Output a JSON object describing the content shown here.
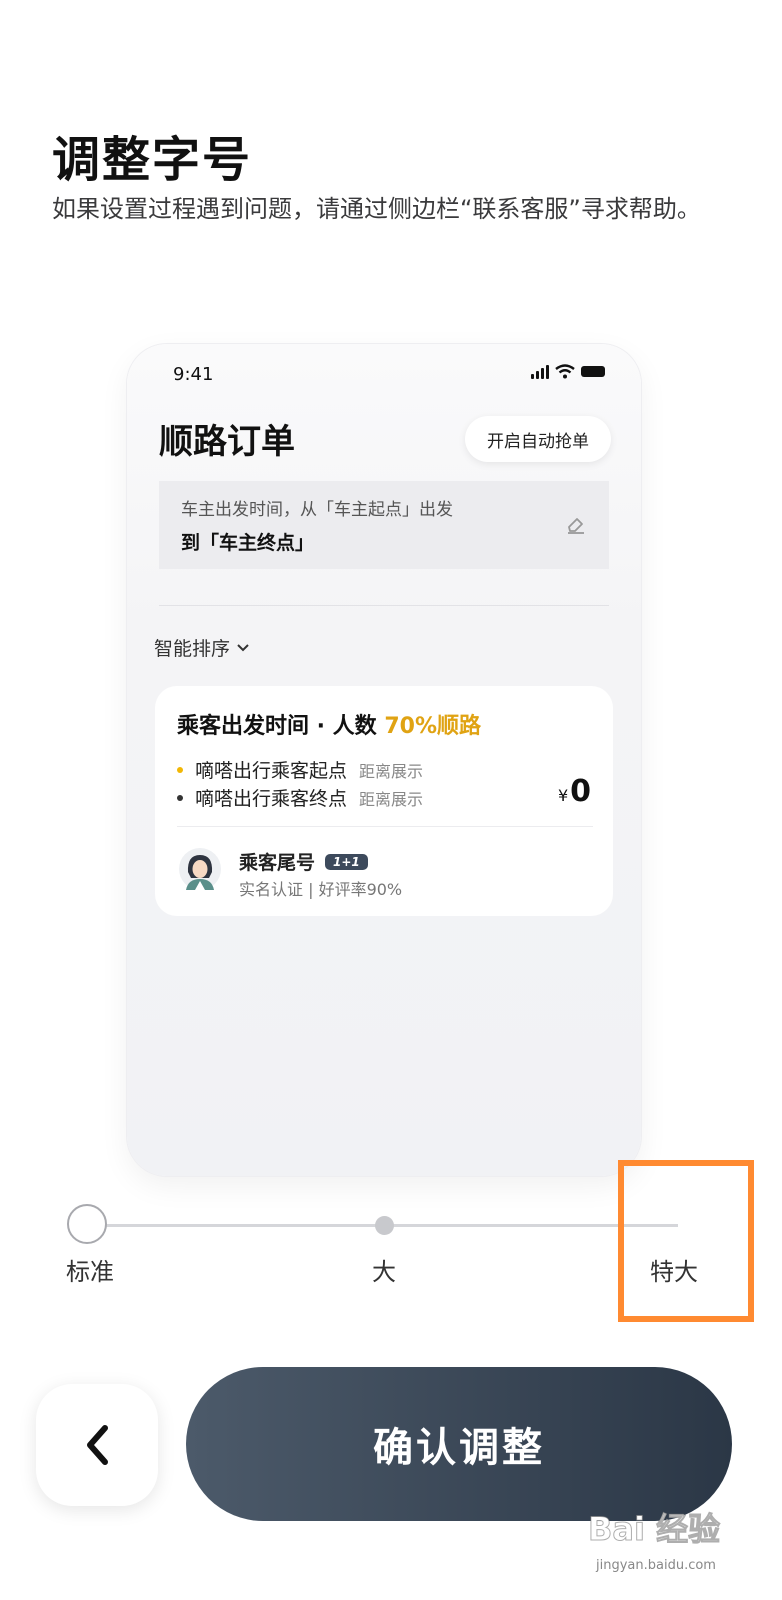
{
  "page": {
    "title": "调整字号",
    "description": "如果设置过程遇到问题，请通过侧边栏“联系客服”寻求帮助。"
  },
  "preview": {
    "status_time": "9:41",
    "order_title": "顺路订单",
    "auto_grab_label": "开启自动抢单",
    "route_line1": "车主出发时间，从「车主起点」出发",
    "route_line2": "到「车主终点」",
    "sort_label": "智能排序",
    "card": {
      "head_text": "乘客出发时间 · 人数",
      "match_percent": "70%顺路",
      "start_point": "嘀嗒出行乘客起点",
      "start_sub": "距离展示",
      "end_point": "嘀嗒出行乘客终点",
      "end_sub": "距离展示",
      "price_symbol": "¥",
      "price_value": "0",
      "passenger_name": "乘客尾号",
      "passenger_badge": "1+1",
      "passenger_info": "实名认证 | 好评率90%"
    },
    "colors": {
      "accent": "#e0a313",
      "start_dot": "#f2b705",
      "end_dot": "#333333"
    }
  },
  "slider": {
    "options": [
      "标准",
      "大",
      "特大"
    ],
    "selected": "标准",
    "highlight_color": "#ff8a31"
  },
  "actions": {
    "back_icon": "chevron-left-icon",
    "confirm_label": "确认调整"
  },
  "watermark": {
    "main": "Bai 经验",
    "sub": "jingyan.baidu.com"
  }
}
